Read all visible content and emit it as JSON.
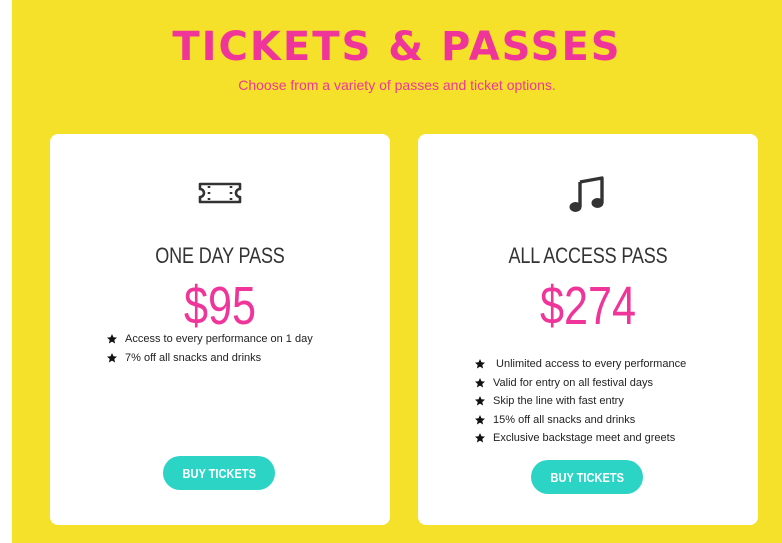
{
  "header": {
    "title": "TICKETS & PASSES",
    "subtitle": "Choose from a variety of passes and ticket options."
  },
  "cards": [
    {
      "icon": "ticket-icon",
      "name": "ONE DAY PASS",
      "price": "$95",
      "features": [
        "Access to every performance on 1 day",
        "7% off all snacks and drinks"
      ],
      "button_label": "BUY TICKETS"
    },
    {
      "icon": "music-note-icon",
      "name": "ALL ACCESS PASS",
      "price": "$274",
      "features": [
        " Unlimited access to every performance",
        "Valid for entry on all festival days",
        "Skip the line with fast entry",
        "15% off all snacks and drinks",
        "Exclusive backstage meet and greets"
      ],
      "button_label": "BUY TICKETS"
    }
  ],
  "colors": {
    "background": "#f6e12a",
    "accent": "#f0359a",
    "button": "#2bd4c4",
    "card": "#ffffff",
    "text": "#333333"
  }
}
